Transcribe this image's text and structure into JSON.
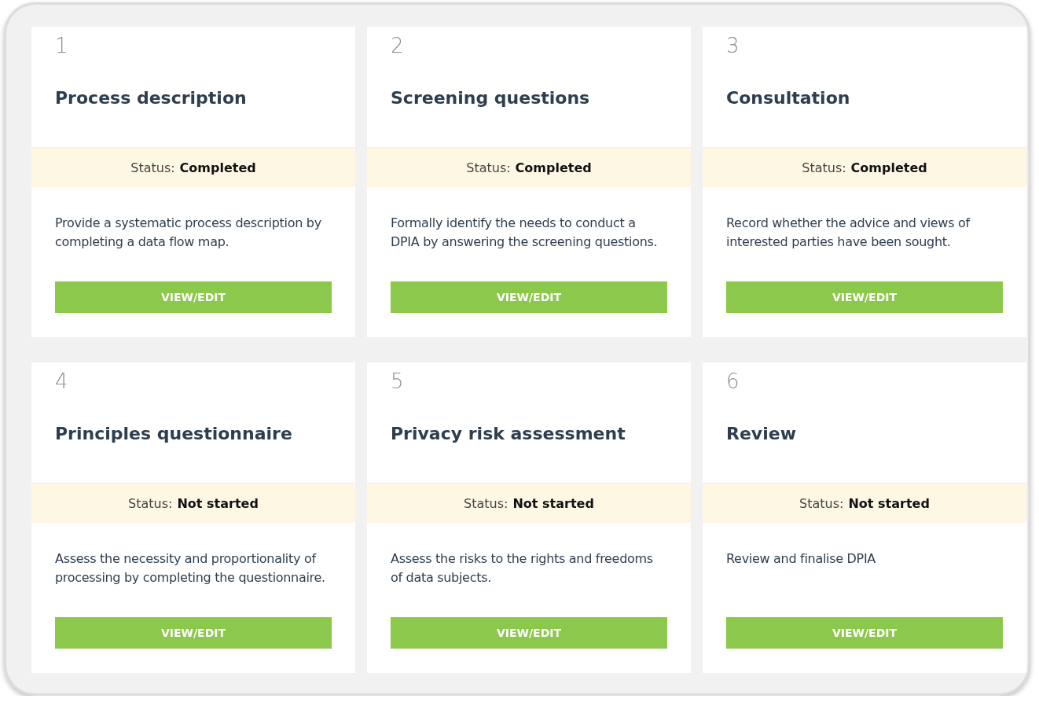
{
  "cards": [
    {
      "number": "1",
      "title": "Process description",
      "status_label": "Status:",
      "status_value": "Completed",
      "description": "Provide a systematic process description by completing a data flow map.",
      "button": "VIEW/EDIT"
    },
    {
      "number": "2",
      "title": "Screening questions",
      "status_label": "Status:",
      "status_value": "Completed",
      "description": "Formally identify the needs to conduct a DPIA by answering the screening questions.",
      "button": "VIEW/EDIT"
    },
    {
      "number": "3",
      "title": "Consultation",
      "status_label": "Status:",
      "status_value": "Completed",
      "description": "Record whether the advice and views of interested parties have been sought.",
      "button": "VIEW/EDIT"
    },
    {
      "number": "4",
      "title": "Principles questionnaire",
      "status_label": "Status:",
      "status_value": "Not started",
      "description": "Assess the necessity and proportionality of processing by completing the questionnaire.",
      "button": "VIEW/EDIT"
    },
    {
      "number": "5",
      "title": "Privacy risk assessment",
      "status_label": "Status:",
      "status_value": "Not started",
      "description": "Assess the risks to the rights and freedoms of data subjects.",
      "button": "VIEW/EDIT"
    },
    {
      "number": "6",
      "title": "Review",
      "status_label": "Status:",
      "status_value": "Not started",
      "description": "Review and finalise DPIA",
      "button": "VIEW/EDIT"
    }
  ]
}
